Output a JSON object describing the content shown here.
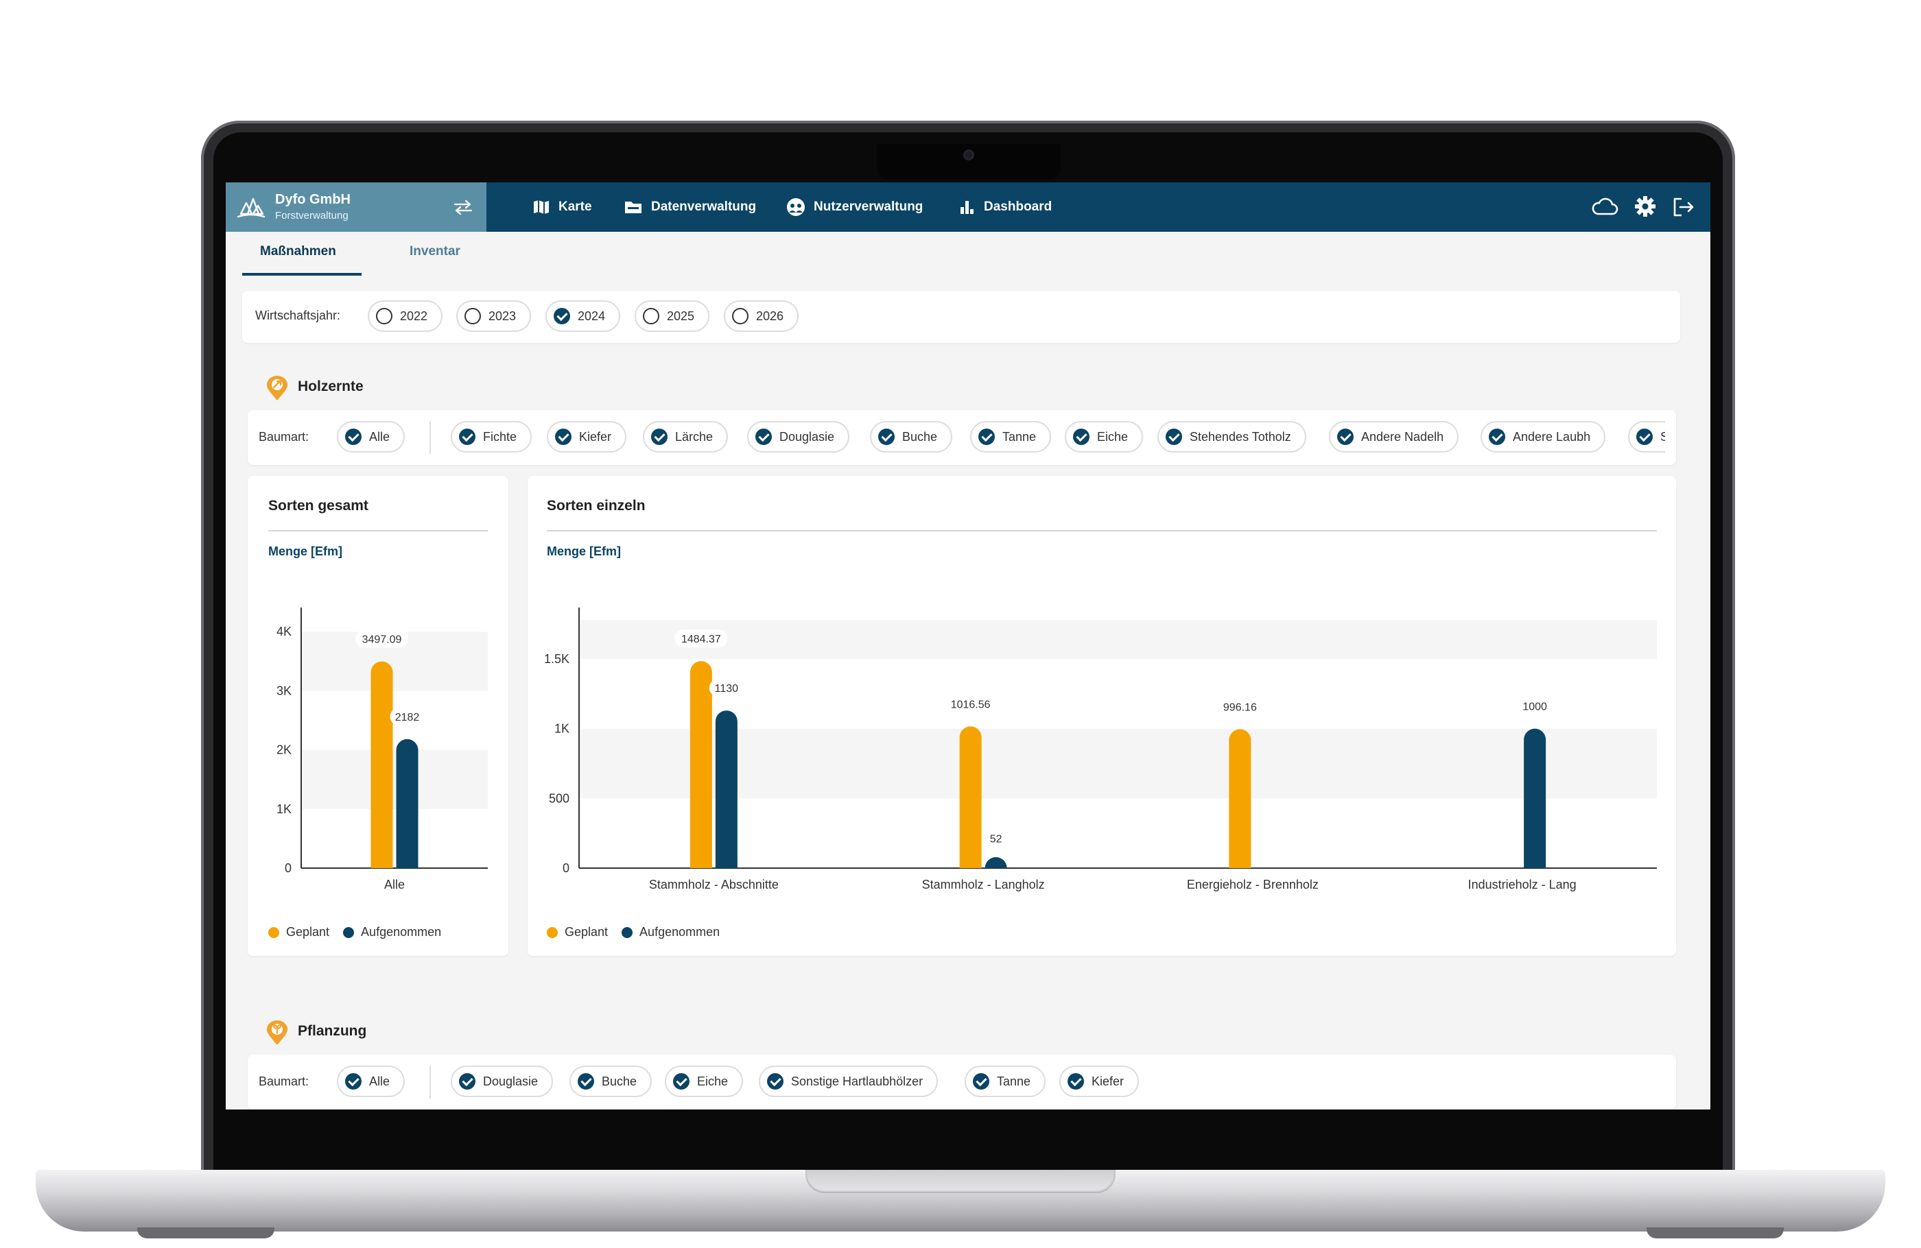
{
  "colors": {
    "primary": "#0b4464",
    "brand_panel": "#5b8fa6",
    "planned": "#f5a300",
    "recorded": "#0b4464",
    "icon_orange": "#f0a22b"
  },
  "brand": {
    "name": "Dyfo GmbH",
    "subtitle": "Forstverwaltung",
    "logo_icon": "forest-logo-icon",
    "swap_icon": "swap-arrows-icon"
  },
  "nav": [
    {
      "label": "Karte",
      "icon": "map-icon"
    },
    {
      "label": "Datenverwaltung",
      "icon": "folder-icon"
    },
    {
      "label": "Nutzerverwaltung",
      "icon": "user-circle-icon"
    },
    {
      "label": "Dashboard",
      "icon": "bar-chart-icon"
    }
  ],
  "top_actions": {
    "cloud": "cloud-icon",
    "settings": "gear-icon",
    "logout": "logout-icon"
  },
  "tabs": [
    {
      "label": "Maßnahmen",
      "active": true
    },
    {
      "label": "Inventar",
      "active": false
    }
  ],
  "fiscal_year": {
    "label": "Wirtschaftsjahr:",
    "options": [
      {
        "label": "2022",
        "checked": false
      },
      {
        "label": "2023",
        "checked": false
      },
      {
        "label": "2024",
        "checked": true
      },
      {
        "label": "2025",
        "checked": false
      },
      {
        "label": "2026",
        "checked": false
      }
    ]
  },
  "holzernte": {
    "title": "Holzernte",
    "filter_label": "Baumart:",
    "all_chip": "Alle",
    "species": [
      "Fichte",
      "Kiefer",
      "Lärche",
      "Douglasie",
      "Buche",
      "Tanne",
      "Eiche",
      "Stehendes Totholz",
      "Andere Nadelh",
      "Andere Laubh",
      "Sc"
    ],
    "charts": {
      "gesamt_title": "Sorten gesamt",
      "einzeln_title": "Sorten einzeln",
      "unit_label": "Menge [Efm]",
      "legend_planned": "Geplant",
      "legend_recorded": "Aufgenommen"
    }
  },
  "pflanzung": {
    "title": "Pflanzung",
    "filter_label": "Baumart:",
    "all_chip": "Alle",
    "species": [
      "Douglasie",
      "Buche",
      "Eiche",
      "Sonstige Hartlaubhölzer",
      "Tanne",
      "Kiefer"
    ]
  },
  "chart_data": [
    {
      "type": "bar",
      "title": "Sorten gesamt",
      "ylabel": "Menge [Efm]",
      "categories": [
        "Alle"
      ],
      "series": [
        {
          "name": "Geplant",
          "values": [
            3497.09
          ],
          "labels": [
            "3497.09"
          ]
        },
        {
          "name": "Aufgenommen",
          "values": [
            2182
          ],
          "labels": [
            "2182"
          ]
        }
      ],
      "ylim": [
        0,
        4200
      ],
      "yticks": [
        0,
        1000,
        2000,
        3000,
        4000
      ],
      "ytick_labels": [
        "0",
        "1K",
        "2K",
        "3K",
        "4K"
      ],
      "legend": "bottom-left"
    },
    {
      "type": "bar",
      "title": "Sorten einzeln",
      "ylabel": "Menge [Efm]",
      "categories": [
        "Stammholz - Abschnitte",
        "Stammholz - Langholz",
        "Energieholz - Brennholz",
        "Industrieholz - Lang"
      ],
      "series": [
        {
          "name": "Geplant",
          "values": [
            1484.37,
            1016.56,
            996.16,
            null
          ],
          "labels": [
            "1484.37",
            "1016.56",
            "996.16",
            ""
          ]
        },
        {
          "name": "Aufgenommen",
          "values": [
            1130,
            52,
            null,
            1000
          ],
          "labels": [
            "1130",
            "52",
            "",
            "1000"
          ]
        }
      ],
      "ylim": [
        0,
        1780
      ],
      "yticks": [
        0,
        500,
        1000,
        1500
      ],
      "ytick_labels": [
        "0",
        "500",
        "1K",
        "1.5K"
      ],
      "legend": "bottom-left"
    }
  ]
}
